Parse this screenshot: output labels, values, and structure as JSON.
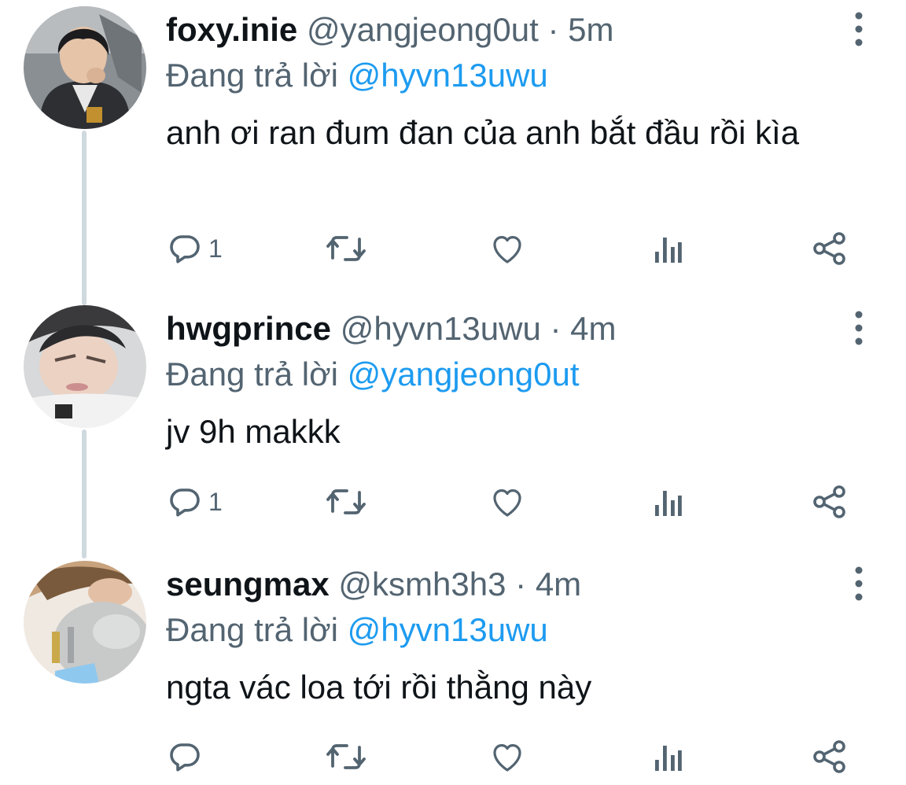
{
  "replying_prefix": "Đang trả lời",
  "colors": {
    "text": "#0f1419",
    "secondary": "#536471",
    "link": "#1d9bf0",
    "thread_line": "#cfd9de"
  },
  "icons": {
    "reply": "reply-icon",
    "retweet": "retweet-icon",
    "like": "heart-icon",
    "views": "views-icon",
    "share": "share-icon",
    "more": "more-vertical-icon"
  },
  "tweets": [
    {
      "name": "foxy.inie",
      "handle": "@yangjeong0ut",
      "separator": "·",
      "time": "5m",
      "replying_to": "@hyvn13uwu",
      "text": "anh ơi ran đum đan của anh bắt đầu rồi kìa",
      "reply_count": "1"
    },
    {
      "name": "hwgprince",
      "handle": "@hyvn13uwu",
      "separator": "·",
      "time": "4m",
      "replying_to": "@yangjeong0ut",
      "text": "jv 9h makkk",
      "reply_count": "1"
    },
    {
      "name": "seungmax",
      "handle": "@ksmh3h3",
      "separator": "·",
      "time": "4m",
      "replying_to": "@hyvn13uwu",
      "text": "ngta vác loa tới rồi thằng này",
      "reply_count": ""
    }
  ]
}
